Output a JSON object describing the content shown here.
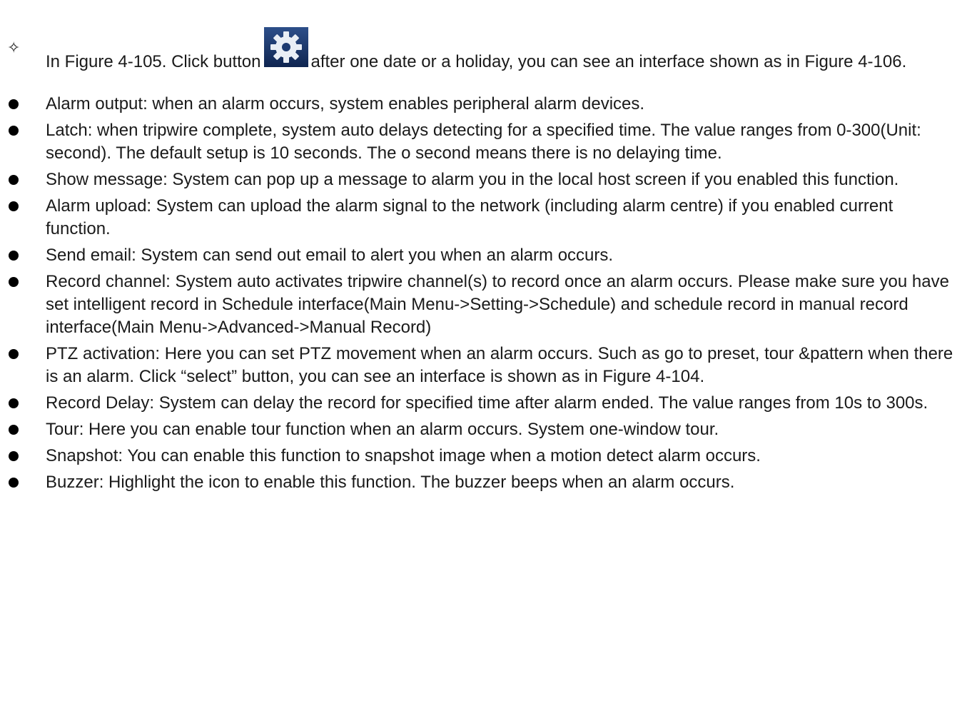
{
  "intro": {
    "text_before": "In Figure 4-105. Click button",
    "text_after": "after one date or a holiday, you can see an interface shown as in Figure 4-106.",
    "icon": "gear-icon"
  },
  "bullets": [
    "Alarm output: when an alarm occurs, system enables peripheral alarm devices.",
    "Latch: when tripwire complete, system auto delays detecting for a specified time. The value ranges from 0-300(Unit: second). The default setup is 10 seconds. The o second means there is no delaying time.",
    "Show message: System can pop up a message to alarm you in the local host screen if you enabled this function.",
    "Alarm upload: System can upload the alarm signal to the network (including alarm centre) if you enabled current function.",
    "Send email: System can send out email to alert you when an alarm occurs.",
    "Record channel: System auto activates tripwire channel(s) to record once an alarm occurs. Please make sure you have set intelligent record in Schedule interface(Main Menu->Setting->Schedule) and schedule record in manual record interface(Main Menu->Advanced->Manual Record)",
    "PTZ activation: Here you can set PTZ movement when an alarm occurs. Such as go to preset, tour &pattern when there is an alarm. Click “select” button, you can see an interface is shown as in Figure 4-104.",
    "Record Delay: System can delay the record for specified time after alarm ended. The value ranges from 10s to 300s.",
    "Tour: Here you can enable tour function when an alarm occurs. System one-window tour.",
    "Snapshot: You can enable this function to snapshot image when a motion detect alarm occurs.",
    "Buzzer: Highlight the icon to enable this function. The buzzer beeps when an alarm occurs."
  ]
}
